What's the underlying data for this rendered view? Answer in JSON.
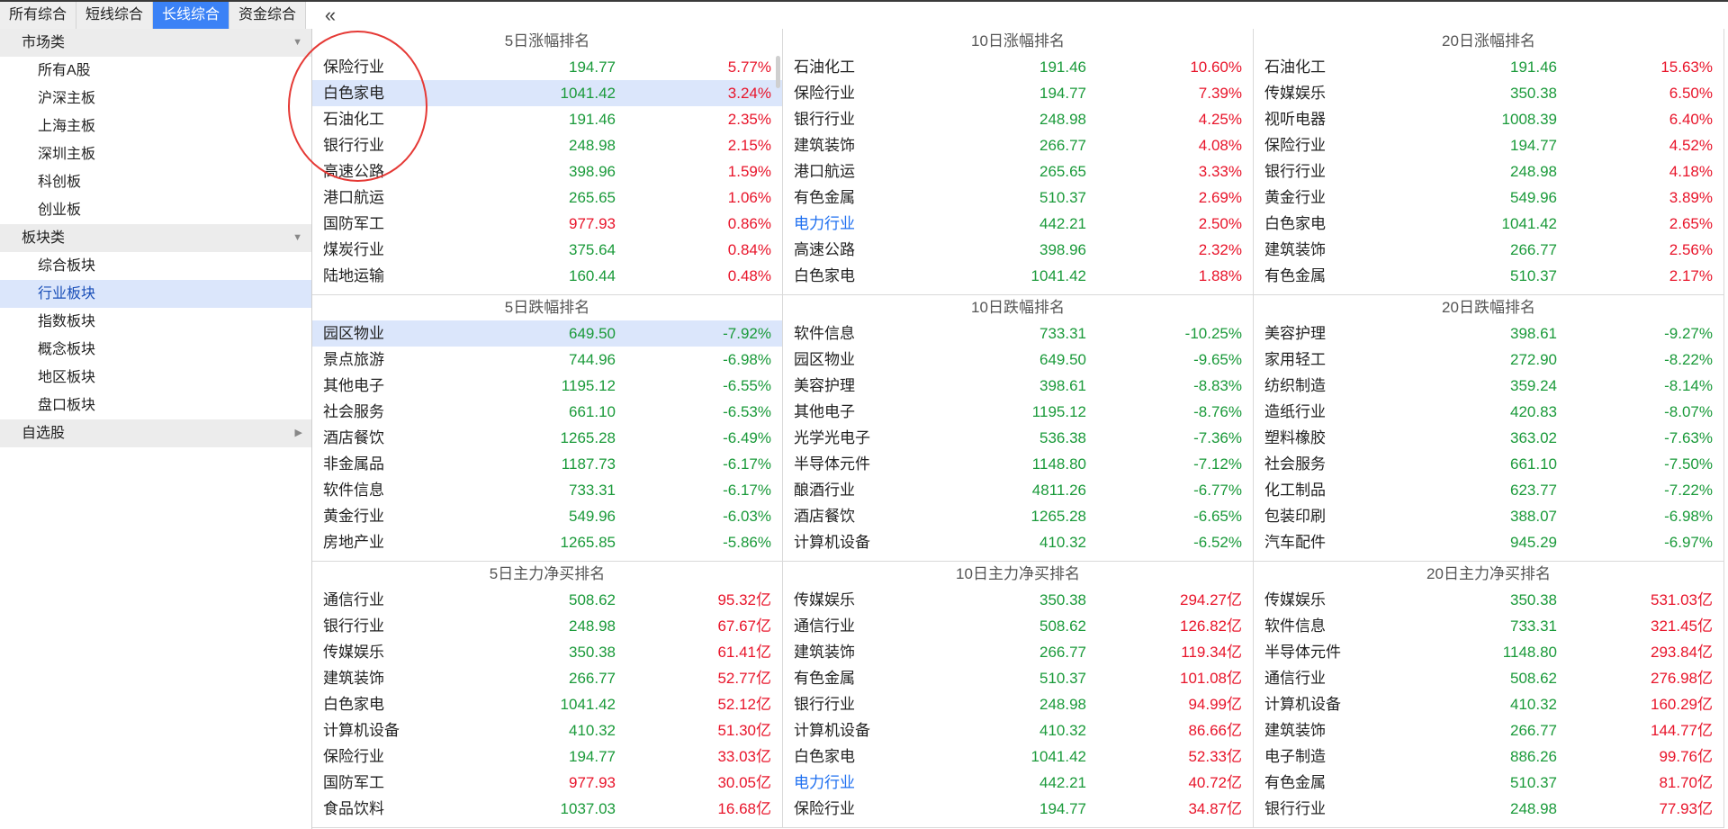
{
  "tabs": [
    {
      "label": "所有综合",
      "active": false
    },
    {
      "label": "短线综合",
      "active": false
    },
    {
      "label": "长线综合",
      "active": true
    },
    {
      "label": "资金综合",
      "active": false
    }
  ],
  "collapse_glyph": "«",
  "sidebar": {
    "groups": [
      {
        "label": "市场类",
        "arrow": "▼",
        "items": [
          "所有A股",
          "沪深主板",
          "上海主板",
          "深圳主板",
          "科创板",
          "创业板"
        ]
      },
      {
        "label": "板块类",
        "arrow": "▼",
        "items": [
          "综合板块",
          "行业板块",
          "指数板块",
          "概念板块",
          "地区板块",
          "盘口板块"
        ]
      },
      {
        "label": "自选股",
        "arrow": "▶",
        "items": []
      }
    ],
    "selected": "行业板块"
  },
  "colors": {
    "up": "#e8142a",
    "down": "#1a9a3a",
    "accent": "#3b82f6",
    "highlight": "#dbe6fb",
    "annotation": "#e53935"
  },
  "panels": [
    {
      "title": "5日涨幅排名",
      "rows": [
        {
          "name": "保险行业",
          "price": "194.77",
          "change": "5.77%",
          "pc": "green",
          "cc": "red"
        },
        {
          "name": "白色家电",
          "price": "1041.42",
          "change": "3.24%",
          "pc": "green",
          "cc": "red",
          "hl": true
        },
        {
          "name": "石油化工",
          "price": "191.46",
          "change": "2.35%",
          "pc": "green",
          "cc": "red"
        },
        {
          "name": "银行行业",
          "price": "248.98",
          "change": "2.15%",
          "pc": "green",
          "cc": "red"
        },
        {
          "name": "高速公路",
          "price": "398.96",
          "change": "1.59%",
          "pc": "green",
          "cc": "red"
        },
        {
          "name": "港口航运",
          "price": "265.65",
          "change": "1.06%",
          "pc": "green",
          "cc": "red"
        },
        {
          "name": "国防军工",
          "price": "977.93",
          "change": "0.86%",
          "pc": "red",
          "cc": "red"
        },
        {
          "name": "煤炭行业",
          "price": "375.64",
          "change": "0.84%",
          "pc": "green",
          "cc": "red"
        },
        {
          "name": "陆地运输",
          "price": "160.44",
          "change": "0.48%",
          "pc": "green",
          "cc": "red"
        }
      ]
    },
    {
      "title": "10日涨幅排名",
      "rows": [
        {
          "name": "石油化工",
          "price": "191.46",
          "change": "10.60%",
          "pc": "green",
          "cc": "red"
        },
        {
          "name": "保险行业",
          "price": "194.77",
          "change": "7.39%",
          "pc": "green",
          "cc": "red"
        },
        {
          "name": "银行行业",
          "price": "248.98",
          "change": "4.25%",
          "pc": "green",
          "cc": "red"
        },
        {
          "name": "建筑装饰",
          "price": "266.77",
          "change": "4.08%",
          "pc": "green",
          "cc": "red"
        },
        {
          "name": "港口航运",
          "price": "265.65",
          "change": "3.33%",
          "pc": "green",
          "cc": "red"
        },
        {
          "name": "有色金属",
          "price": "510.37",
          "change": "2.69%",
          "pc": "green",
          "cc": "red"
        },
        {
          "name": "电力行业",
          "price": "442.21",
          "change": "2.50%",
          "pc": "green",
          "cc": "red",
          "blue": true
        },
        {
          "name": "高速公路",
          "price": "398.96",
          "change": "2.32%",
          "pc": "green",
          "cc": "red"
        },
        {
          "name": "白色家电",
          "price": "1041.42",
          "change": "1.88%",
          "pc": "green",
          "cc": "red"
        }
      ]
    },
    {
      "title": "20日涨幅排名",
      "rows": [
        {
          "name": "石油化工",
          "price": "191.46",
          "change": "15.63%",
          "pc": "green",
          "cc": "red"
        },
        {
          "name": "传媒娱乐",
          "price": "350.38",
          "change": "6.50%",
          "pc": "green",
          "cc": "red"
        },
        {
          "name": "视听电器",
          "price": "1008.39",
          "change": "6.40%",
          "pc": "green",
          "cc": "red"
        },
        {
          "name": "保险行业",
          "price": "194.77",
          "change": "4.52%",
          "pc": "green",
          "cc": "red"
        },
        {
          "name": "银行行业",
          "price": "248.98",
          "change": "4.18%",
          "pc": "green",
          "cc": "red"
        },
        {
          "name": "黄金行业",
          "price": "549.96",
          "change": "3.89%",
          "pc": "green",
          "cc": "red"
        },
        {
          "name": "白色家电",
          "price": "1041.42",
          "change": "2.65%",
          "pc": "green",
          "cc": "red"
        },
        {
          "name": "建筑装饰",
          "price": "266.77",
          "change": "2.56%",
          "pc": "green",
          "cc": "red"
        },
        {
          "name": "有色金属",
          "price": "510.37",
          "change": "2.17%",
          "pc": "green",
          "cc": "red"
        }
      ]
    },
    {
      "title": "5日跌幅排名",
      "rows": [
        {
          "name": "园区物业",
          "price": "649.50",
          "change": "-7.92%",
          "pc": "green",
          "cc": "green",
          "hl": true
        },
        {
          "name": "景点旅游",
          "price": "744.96",
          "change": "-6.98%",
          "pc": "green",
          "cc": "green"
        },
        {
          "name": "其他电子",
          "price": "1195.12",
          "change": "-6.55%",
          "pc": "green",
          "cc": "green"
        },
        {
          "name": "社会服务",
          "price": "661.10",
          "change": "-6.53%",
          "pc": "green",
          "cc": "green"
        },
        {
          "name": "酒店餐饮",
          "price": "1265.28",
          "change": "-6.49%",
          "pc": "green",
          "cc": "green"
        },
        {
          "name": "非金属品",
          "price": "1187.73",
          "change": "-6.17%",
          "pc": "green",
          "cc": "green"
        },
        {
          "name": "软件信息",
          "price": "733.31",
          "change": "-6.17%",
          "pc": "green",
          "cc": "green"
        },
        {
          "name": "黄金行业",
          "price": "549.96",
          "change": "-6.03%",
          "pc": "green",
          "cc": "green"
        },
        {
          "name": "房地产业",
          "price": "1265.85",
          "change": "-5.86%",
          "pc": "green",
          "cc": "green"
        }
      ]
    },
    {
      "title": "10日跌幅排名",
      "rows": [
        {
          "name": "软件信息",
          "price": "733.31",
          "change": "-10.25%",
          "pc": "green",
          "cc": "green"
        },
        {
          "name": "园区物业",
          "price": "649.50",
          "change": "-9.65%",
          "pc": "green",
          "cc": "green"
        },
        {
          "name": "美容护理",
          "price": "398.61",
          "change": "-8.83%",
          "pc": "green",
          "cc": "green"
        },
        {
          "name": "其他电子",
          "price": "1195.12",
          "change": "-8.76%",
          "pc": "green",
          "cc": "green"
        },
        {
          "name": "光学光电子",
          "price": "536.38",
          "change": "-7.36%",
          "pc": "green",
          "cc": "green"
        },
        {
          "name": "半导体元件",
          "price": "1148.80",
          "change": "-7.12%",
          "pc": "green",
          "cc": "green"
        },
        {
          "name": "酿酒行业",
          "price": "4811.26",
          "change": "-6.77%",
          "pc": "green",
          "cc": "green"
        },
        {
          "name": "酒店餐饮",
          "price": "1265.28",
          "change": "-6.65%",
          "pc": "green",
          "cc": "green"
        },
        {
          "name": "计算机设备",
          "price": "410.32",
          "change": "-6.52%",
          "pc": "green",
          "cc": "green"
        }
      ]
    },
    {
      "title": "20日跌幅排名",
      "rows": [
        {
          "name": "美容护理",
          "price": "398.61",
          "change": "-9.27%",
          "pc": "green",
          "cc": "green"
        },
        {
          "name": "家用轻工",
          "price": "272.90",
          "change": "-8.22%",
          "pc": "green",
          "cc": "green"
        },
        {
          "name": "纺织制造",
          "price": "359.24",
          "change": "-8.14%",
          "pc": "green",
          "cc": "green"
        },
        {
          "name": "造纸行业",
          "price": "420.83",
          "change": "-8.07%",
          "pc": "green",
          "cc": "green"
        },
        {
          "name": "塑料橡胶",
          "price": "363.02",
          "change": "-7.63%",
          "pc": "green",
          "cc": "green"
        },
        {
          "name": "社会服务",
          "price": "661.10",
          "change": "-7.50%",
          "pc": "green",
          "cc": "green"
        },
        {
          "name": "化工制品",
          "price": "623.77",
          "change": "-7.22%",
          "pc": "green",
          "cc": "green"
        },
        {
          "name": "包装印刷",
          "price": "388.07",
          "change": "-6.98%",
          "pc": "green",
          "cc": "green"
        },
        {
          "name": "汽车配件",
          "price": "945.29",
          "change": "-6.97%",
          "pc": "green",
          "cc": "green"
        }
      ]
    },
    {
      "title": "5日主力净买排名",
      "rows": [
        {
          "name": "通信行业",
          "price": "508.62",
          "change": "95.32亿",
          "pc": "green",
          "cc": "red"
        },
        {
          "name": "银行行业",
          "price": "248.98",
          "change": "67.67亿",
          "pc": "green",
          "cc": "red"
        },
        {
          "name": "传媒娱乐",
          "price": "350.38",
          "change": "61.41亿",
          "pc": "green",
          "cc": "red"
        },
        {
          "name": "建筑装饰",
          "price": "266.77",
          "change": "52.77亿",
          "pc": "green",
          "cc": "red"
        },
        {
          "name": "白色家电",
          "price": "1041.42",
          "change": "52.12亿",
          "pc": "green",
          "cc": "red"
        },
        {
          "name": "计算机设备",
          "price": "410.32",
          "change": "51.30亿",
          "pc": "green",
          "cc": "red"
        },
        {
          "name": "保险行业",
          "price": "194.77",
          "change": "33.03亿",
          "pc": "green",
          "cc": "red"
        },
        {
          "name": "国防军工",
          "price": "977.93",
          "change": "30.05亿",
          "pc": "red",
          "cc": "red"
        },
        {
          "name": "食品饮料",
          "price": "1037.03",
          "change": "16.68亿",
          "pc": "green",
          "cc": "red"
        }
      ]
    },
    {
      "title": "10日主力净买排名",
      "rows": [
        {
          "name": "传媒娱乐",
          "price": "350.38",
          "change": "294.27亿",
          "pc": "green",
          "cc": "red"
        },
        {
          "name": "通信行业",
          "price": "508.62",
          "change": "126.82亿",
          "pc": "green",
          "cc": "red"
        },
        {
          "name": "建筑装饰",
          "price": "266.77",
          "change": "119.34亿",
          "pc": "green",
          "cc": "red"
        },
        {
          "name": "有色金属",
          "price": "510.37",
          "change": "101.08亿",
          "pc": "green",
          "cc": "red"
        },
        {
          "name": "银行行业",
          "price": "248.98",
          "change": "94.99亿",
          "pc": "green",
          "cc": "red"
        },
        {
          "name": "计算机设备",
          "price": "410.32",
          "change": "86.66亿",
          "pc": "green",
          "cc": "red"
        },
        {
          "name": "白色家电",
          "price": "1041.42",
          "change": "52.33亿",
          "pc": "green",
          "cc": "red"
        },
        {
          "name": "电力行业",
          "price": "442.21",
          "change": "40.72亿",
          "pc": "green",
          "cc": "red",
          "blue": true
        },
        {
          "name": "保险行业",
          "price": "194.77",
          "change": "34.87亿",
          "pc": "green",
          "cc": "red"
        }
      ]
    },
    {
      "title": "20日主力净买排名",
      "rows": [
        {
          "name": "传媒娱乐",
          "price": "350.38",
          "change": "531.03亿",
          "pc": "green",
          "cc": "red"
        },
        {
          "name": "软件信息",
          "price": "733.31",
          "change": "321.45亿",
          "pc": "green",
          "cc": "red"
        },
        {
          "name": "半导体元件",
          "price": "1148.80",
          "change": "293.84亿",
          "pc": "green",
          "cc": "red"
        },
        {
          "name": "通信行业",
          "price": "508.62",
          "change": "276.98亿",
          "pc": "green",
          "cc": "red"
        },
        {
          "name": "计算机设备",
          "price": "410.32",
          "change": "160.29亿",
          "pc": "green",
          "cc": "red"
        },
        {
          "name": "建筑装饰",
          "price": "266.77",
          "change": "144.77亿",
          "pc": "green",
          "cc": "red"
        },
        {
          "name": "电子制造",
          "price": "886.26",
          "change": "99.76亿",
          "pc": "green",
          "cc": "red"
        },
        {
          "name": "有色金属",
          "price": "510.37",
          "change": "81.70亿",
          "pc": "green",
          "cc": "red"
        },
        {
          "name": "银行行业",
          "price": "248.98",
          "change": "77.93亿",
          "pc": "green",
          "cc": "red"
        }
      ]
    }
  ]
}
